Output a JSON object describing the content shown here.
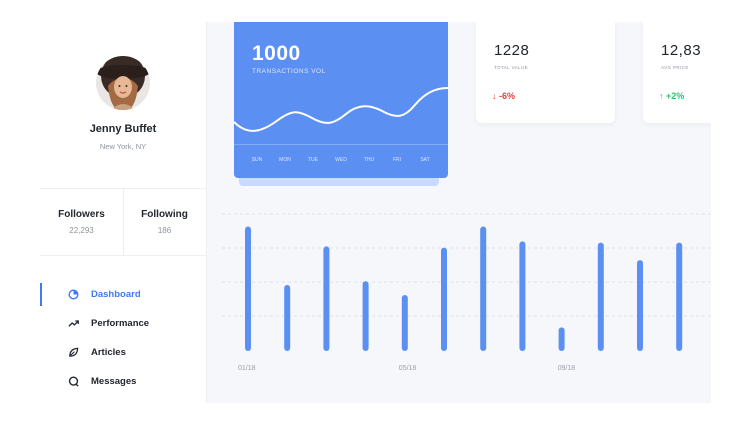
{
  "profile": {
    "name": "Jenny Buffet",
    "location": "New York, NY"
  },
  "stats": {
    "followers_label": "Followers",
    "followers_value": "22,293",
    "following_label": "Following",
    "following_value": "186"
  },
  "nav": {
    "items": [
      {
        "label": "Dashboard",
        "icon": "clock-pie-icon",
        "active": true
      },
      {
        "label": "Performance",
        "icon": "trend-up-icon",
        "active": false
      },
      {
        "label": "Articles",
        "icon": "leaf-icon",
        "active": false
      },
      {
        "label": "Messages",
        "icon": "chat-icon",
        "active": false
      }
    ]
  },
  "transactions": {
    "value": "1000",
    "label": "TRANSACTIONS VOL",
    "days": [
      "SUN",
      "MON",
      "TUE",
      "WED",
      "THU",
      "FRI",
      "SAT"
    ]
  },
  "kpis": [
    {
      "value": "1228",
      "label": "TOTAL VALUE",
      "change": "↓ -6%",
      "trend": "down"
    },
    {
      "value": "12,83",
      "label": "AVG PRICE",
      "change": "↑ +2%",
      "trend": "up"
    }
  ],
  "colors": {
    "accent": "#3d7bf1",
    "card_blue": "#5b8ff2",
    "bar": "#5b8ff2",
    "negative": "#e3403b",
    "positive": "#2fbf71"
  },
  "chart_data": {
    "type": "bar",
    "x_tick_labels": [
      "01/18",
      "05/18",
      "09/18"
    ],
    "values": [
      100,
      53,
      84,
      56,
      45,
      83,
      100,
      88,
      19,
      87,
      73,
      87
    ],
    "ylim": [
      0,
      110
    ],
    "grid": true
  }
}
